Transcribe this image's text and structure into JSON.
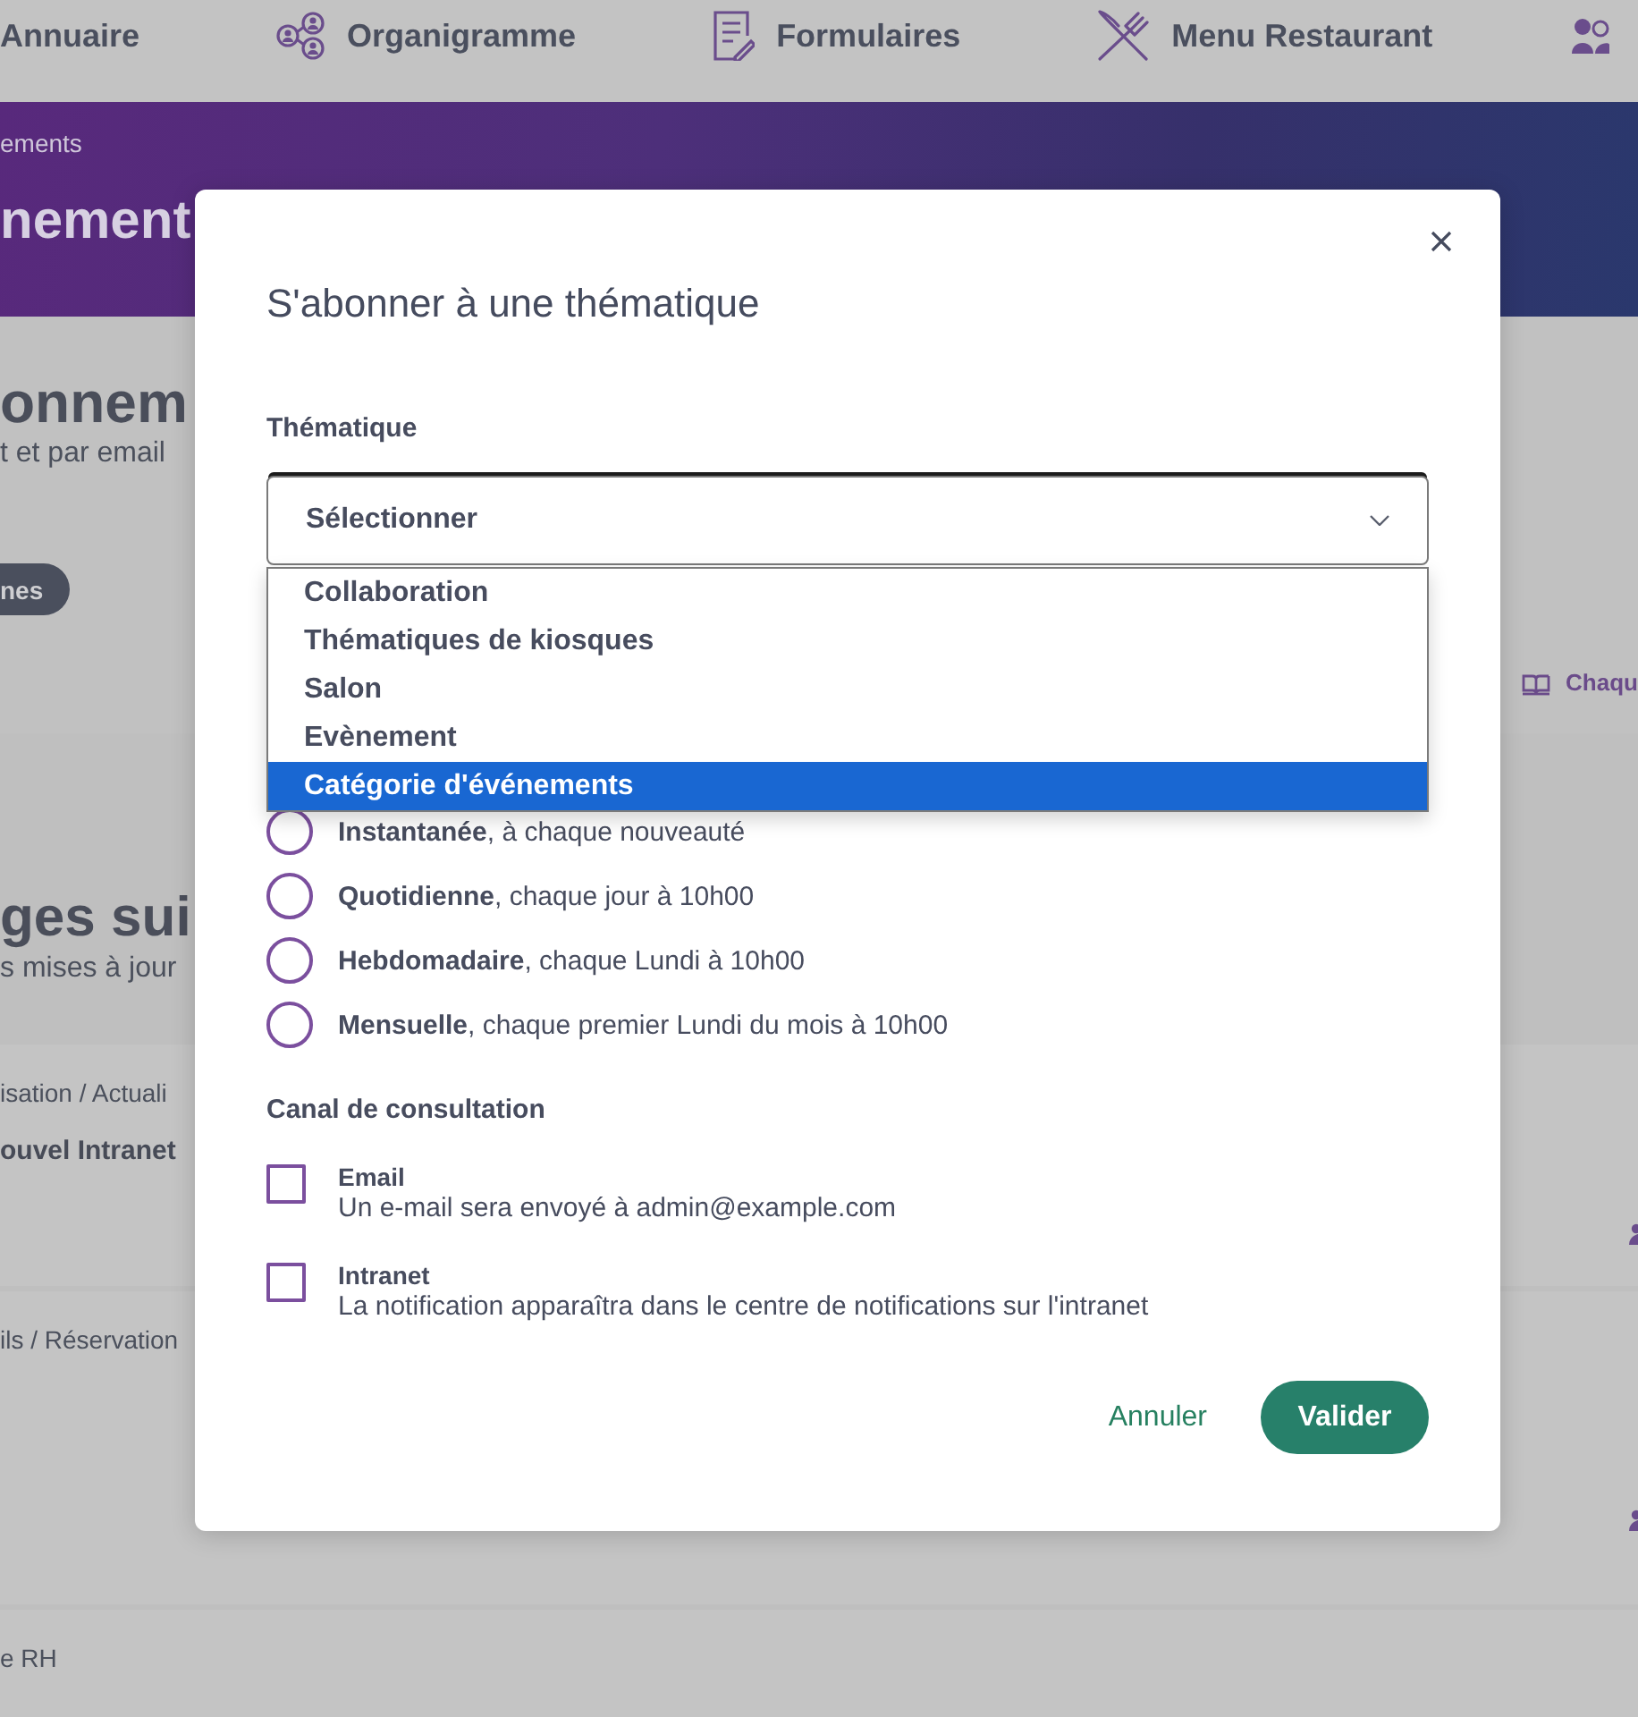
{
  "nav": {
    "items": [
      {
        "label": "Annuaire"
      },
      {
        "label": "Organigramme"
      },
      {
        "label": "Formulaires"
      },
      {
        "label": "Menu Restaurant"
      }
    ]
  },
  "banner": {
    "breadcrumb": "ements",
    "title": "nement"
  },
  "subscriptions": {
    "title": "onnem",
    "subtitle": "t et par email",
    "pill_button": "nes",
    "link": "Chaqu"
  },
  "followed_pages": {
    "title": "ges sui",
    "subtitle": "s mises à jour",
    "cards": [
      {
        "category": "isation / Actuali",
        "title": "ouvel Intranet"
      },
      {
        "category": "ils / Réservation"
      },
      {
        "category": "e RH"
      }
    ]
  },
  "modal": {
    "title": "S'abonner à une thématique",
    "thematique": {
      "label": "Thématique",
      "value": "Sélectionner",
      "expanded": true,
      "options": [
        {
          "label": "Collaboration",
          "selected": false
        },
        {
          "label": "Thématiques de kiosques",
          "selected": false
        },
        {
          "label": "Salon",
          "selected": false
        },
        {
          "label": "Evènement",
          "selected": false
        },
        {
          "label": "Catégorie d'événements",
          "selected": true
        }
      ]
    },
    "frequency": {
      "options": [
        {
          "label": "**Instantanée**, à chaque nouveauté",
          "selected": false
        },
        {
          "label": "**Quotidienne**, chaque jour à 10h00",
          "selected": false
        },
        {
          "label": "**Hebdomadaire**, chaque Lundi à 10h00",
          "selected": false
        },
        {
          "label": "**Mensuelle**, chaque premier Lundi du mois à 10h00",
          "selected": false
        }
      ]
    },
    "channel": {
      "label": "Canal de consultation",
      "options": [
        {
          "title": "Email",
          "description": "Un e-mail sera envoyé à admin@example.com",
          "checked": false
        },
        {
          "title": "Intranet",
          "description": "La notification apparaîtra dans le centre de notifications sur l'intranet",
          "checked": false
        }
      ]
    },
    "buttons": {
      "cancel": "Annuler",
      "submit": "Valider"
    }
  }
}
